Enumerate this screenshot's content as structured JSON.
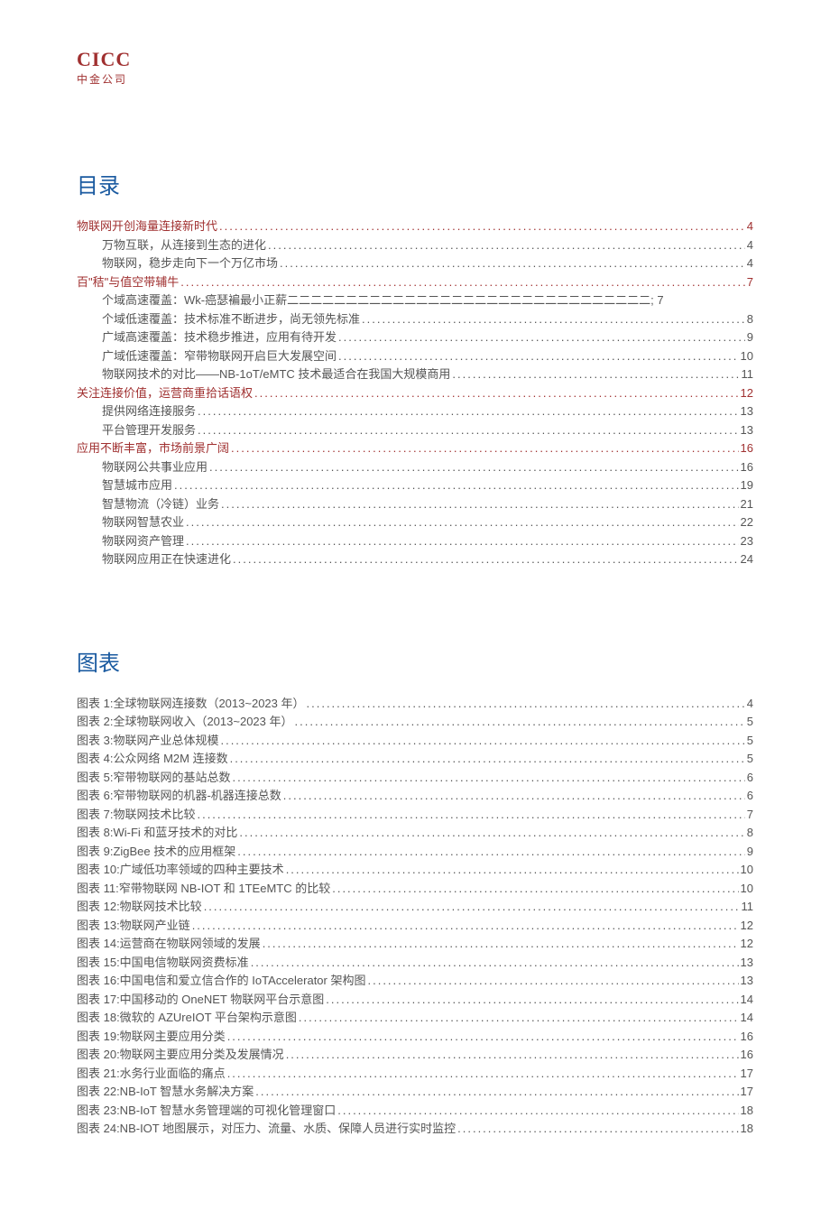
{
  "logo": {
    "en": "CICC",
    "cn": "中金公司"
  },
  "headings": {
    "toc": "目录",
    "figures": "图表"
  },
  "toc": [
    {
      "label": "物联网开创海量连接新时代",
      "page": "4",
      "level": 1
    },
    {
      "label": "万物互联，从连接到生态的进化",
      "page": "4",
      "level": 2
    },
    {
      "label": "物联网，稳步走向下一个万亿市场",
      "page": "4",
      "level": 2
    },
    {
      "label": "百\"秸\"与值空带辅牛",
      "page": "7",
      "level": 1
    },
    {
      "label": "个域高速覆盖：Wk-癌瑟褊最小正薪二二二二二二二二二二二二二二二二二二二二二二二二二二二二二二二; 7",
      "page": "",
      "level": 2,
      "raw": true
    },
    {
      "label": "个域低速覆盖：技术标准不断进步，尚无领先标准",
      "page": "8",
      "level": 2
    },
    {
      "label": "广域高速覆盖：技术稳步推进，应用有待开发",
      "page": "9",
      "level": 2
    },
    {
      "label": "广域低速覆盖：窄带物联网开启巨大发展空间",
      "page": "10",
      "level": 2
    },
    {
      "label": "物联网技术的对比——NB-1oT/eMTC 技术最适合在我国大规模商用",
      "page": "11",
      "level": 2
    },
    {
      "label": "关注连接价值，运营商重拾话语权",
      "page": "12",
      "level": 1
    },
    {
      "label": "提供网络连接服务",
      "page": "13",
      "level": 2
    },
    {
      "label": "平台管理开发服务",
      "page": "13",
      "level": 2
    },
    {
      "label": "应用不断丰富，市场前景广阔",
      "page": "16",
      "level": 1
    },
    {
      "label": "物联网公共事业应用",
      "page": "16",
      "level": 2
    },
    {
      "label": "智慧城市应用",
      "page": "19",
      "level": 2
    },
    {
      "label": "智慧物流（冷链）业务",
      "page": "21",
      "level": 2
    },
    {
      "label": "物联网智慧农业",
      "page": "22",
      "level": 2
    },
    {
      "label": "物联网资产管理",
      "page": "23",
      "level": 2
    },
    {
      "label": "物联网应用正在快速进化",
      "page": "24",
      "level": 2
    }
  ],
  "figures": [
    {
      "label": "图表 1:全球物联网连接数（2013~2023 年）",
      "page": "4"
    },
    {
      "label": "图表 2:全球物联网收入（2013~2023 年）",
      "page": "5"
    },
    {
      "label": "图表 3:物联网产业总体规模",
      "page": "5"
    },
    {
      "label": "图表 4:公众网络 M2M 连接数",
      "page": "5"
    },
    {
      "label": "图表 5:窄带物联网的基站总数",
      "page": "6"
    },
    {
      "label": "图表 6:窄带物联网的机器-机器连接总数",
      "page": "6"
    },
    {
      "label": "图表 7:物联网技术比较",
      "page": "7"
    },
    {
      "label": "图表 8:Wi-Fi 和蓝牙技术的对比",
      "page": "8"
    },
    {
      "label": "图表 9:ZigBee 技术的应用框架",
      "page": "9"
    },
    {
      "label": "图表 10:广域低功率领域的四种主要技术",
      "page": "10"
    },
    {
      "label": "图表 11:窄带物联网 NB-IOT 和 1TEeMTC 的比较",
      "page": "10"
    },
    {
      "label": "图表 12:物联网技术比较",
      "page": "11"
    },
    {
      "label": "图表 13:物联网产业链",
      "page": "12"
    },
    {
      "label": "图表 14:运营商在物联网领域的发展",
      "page": "12"
    },
    {
      "label": "图表 15:中国电信物联网资费标准",
      "page": "13"
    },
    {
      "label": "图表 16:中国电信和爱立信合作的 IoTAccelerator 架构图",
      "page": "13"
    },
    {
      "label": "图表 17:中国移动的 OneNET 物联网平台示意图",
      "page": "14"
    },
    {
      "label": "图表 18:微软的 AZUreIOT 平台架构示意图",
      "page": "14"
    },
    {
      "label": "图表 19:物联网主要应用分类",
      "page": "16"
    },
    {
      "label": "图表 20:物联网主要应用分类及发展情况",
      "page": "16"
    },
    {
      "label": "图表 21:水务行业面临的痛点",
      "page": "17"
    },
    {
      "label": "图表 22:NB-IoT 智慧水务解决方案",
      "page": "17"
    },
    {
      "label": "图表 23:NB-IoT 智慧水务管理端的可视化管理窗口",
      "page": "18"
    },
    {
      "label": "图表 24:NB-IOT 地图展示，对压力、流量、水质、保障人员进行实时监控",
      "page": "18"
    }
  ]
}
